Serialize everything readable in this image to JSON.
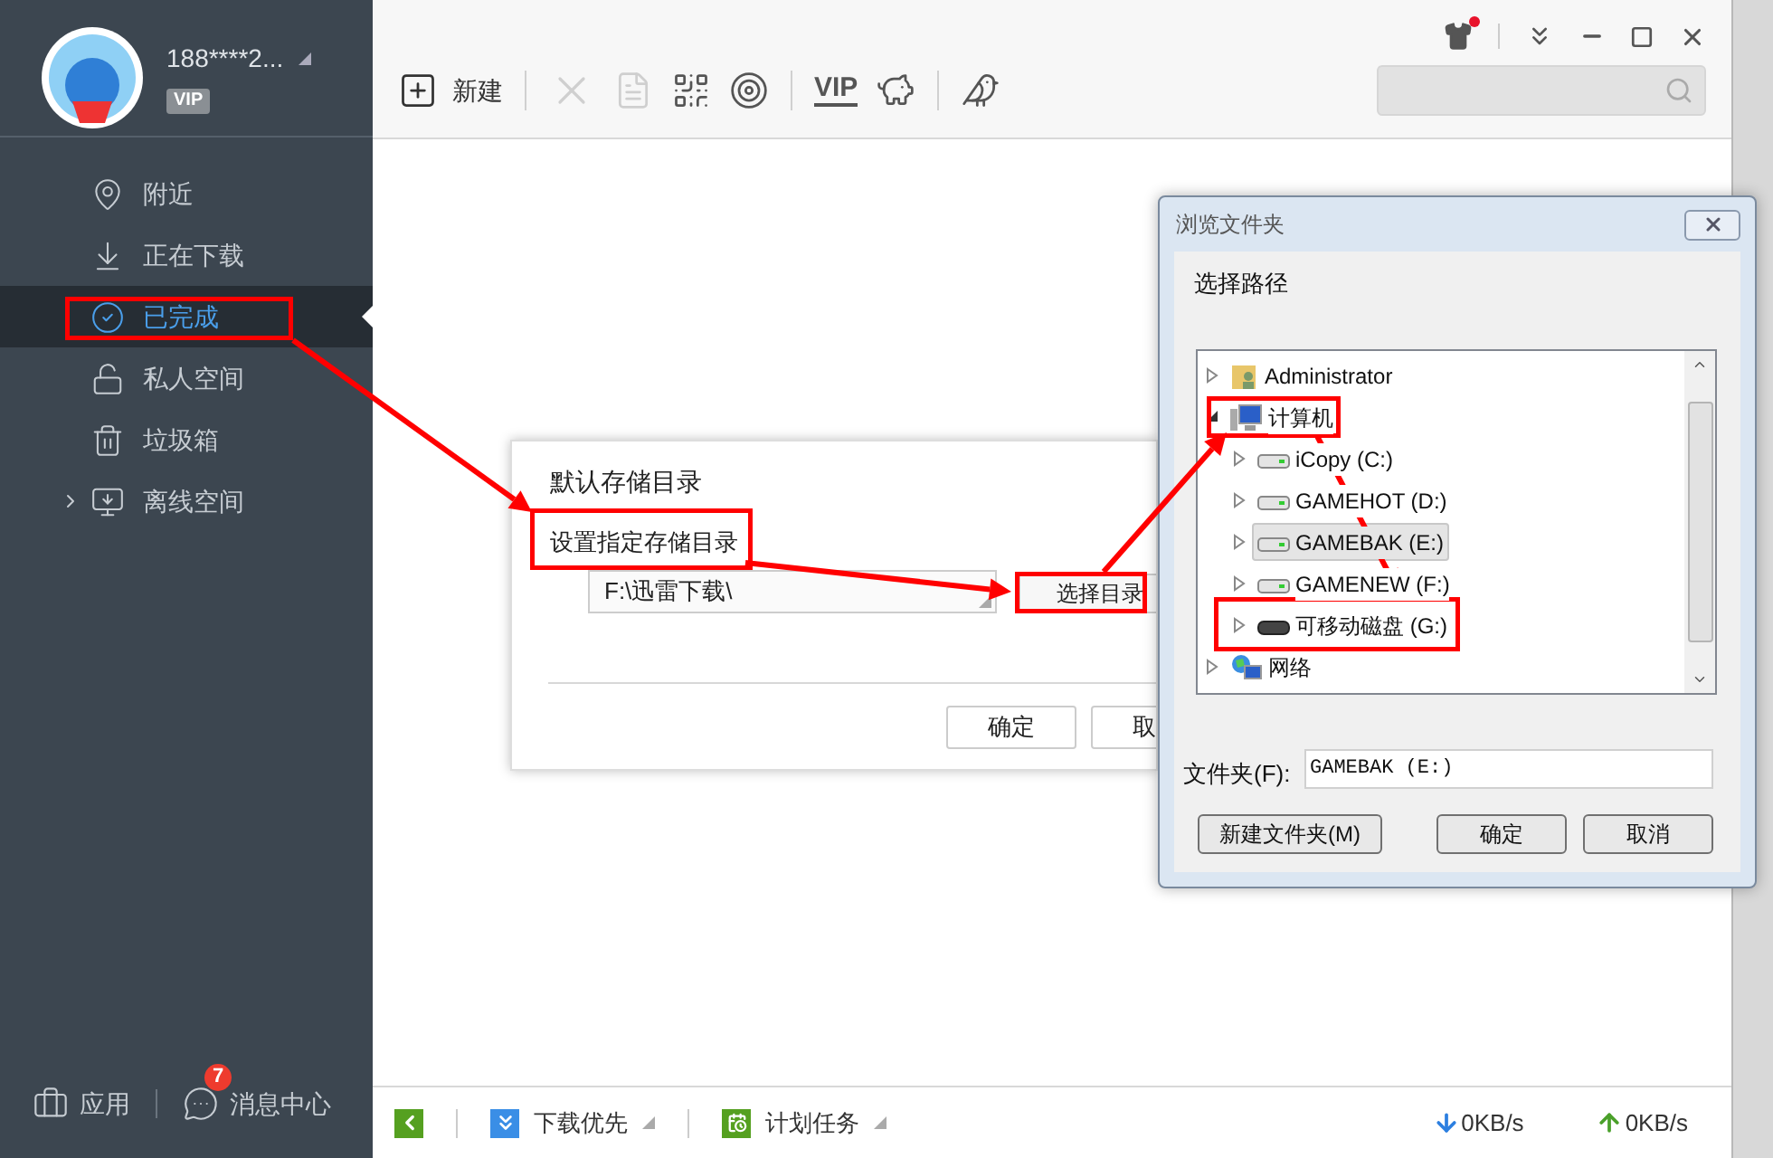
{
  "sidebar": {
    "user": {
      "name": "188****2...",
      "badge": "VIP"
    },
    "nav": [
      {
        "label": "附近",
        "kind": "pin",
        "selected": false,
        "expandable": false
      },
      {
        "label": "正在下载",
        "kind": "download",
        "selected": false,
        "expandable": false
      },
      {
        "label": "已完成",
        "kind": "check",
        "selected": true,
        "expandable": false
      },
      {
        "label": "私人空间",
        "kind": "lock",
        "selected": false,
        "expandable": false
      },
      {
        "label": "垃圾箱",
        "kind": "trash",
        "selected": false,
        "expandable": false
      },
      {
        "label": "离线空间",
        "kind": "cloud",
        "selected": false,
        "expandable": true
      }
    ],
    "footer": [
      {
        "label": "应用",
        "kind": "apps"
      },
      {
        "label": "消息中心",
        "kind": "chat",
        "badge": "7"
      }
    ]
  },
  "titlebar": {
    "skin_notice": true
  },
  "toolbar": {
    "new_label": "新建",
    "tools": [
      {
        "kind": "delete",
        "disabled": true
      },
      {
        "kind": "file",
        "disabled": true
      },
      {
        "kind": "grid",
        "disabled": false
      },
      {
        "kind": "target",
        "disabled": false
      },
      {
        "kind": "vip",
        "label": "VIP",
        "disabled": false
      },
      {
        "kind": "piggy",
        "disabled": false
      },
      {
        "kind": "bird",
        "disabled": false
      }
    ]
  },
  "storage_dialog": {
    "title": "默认存储目录",
    "option": "设置指定存储目录",
    "path": "F:\\迅雷下载\\",
    "choose_button": "选择目录",
    "buttons": [
      "确定",
      "取"
    ]
  },
  "browse_dialog": {
    "title": "浏览文件夹",
    "prompt": "选择路径",
    "tree": [
      {
        "label": "Administrator",
        "kind": "user",
        "expanded": false,
        "selected": false
      },
      {
        "label": "计算机",
        "kind": "computer",
        "expanded": true,
        "selected": false,
        "children": [
          {
            "label": "iCopy (C:)",
            "kind": "drive",
            "expanded": false,
            "selected": false
          },
          {
            "label": "GAMEHOT (D:)",
            "kind": "drive",
            "expanded": false,
            "selected": false
          },
          {
            "label": "GAMEBAK (E:)",
            "kind": "drive",
            "expanded": false,
            "selected": true
          },
          {
            "label": "GAMENEW (F:)",
            "kind": "drive",
            "expanded": false,
            "selected": false
          },
          {
            "label": "可移动磁盘 (G:)",
            "kind": "removable",
            "expanded": false,
            "selected": false
          }
        ]
      },
      {
        "label": "网络",
        "kind": "network",
        "expanded": false,
        "selected": false
      }
    ],
    "folder_label": "文件夹(F):",
    "folder_value": "GAMEBAK (E:)",
    "buttons": [
      "新建文件夹(M)",
      "确定",
      "取消"
    ]
  },
  "status_bar": {
    "priority": "下载优先",
    "schedule": "计划任务",
    "down_speed": "0KB/s",
    "up_speed": "0KB/s"
  }
}
